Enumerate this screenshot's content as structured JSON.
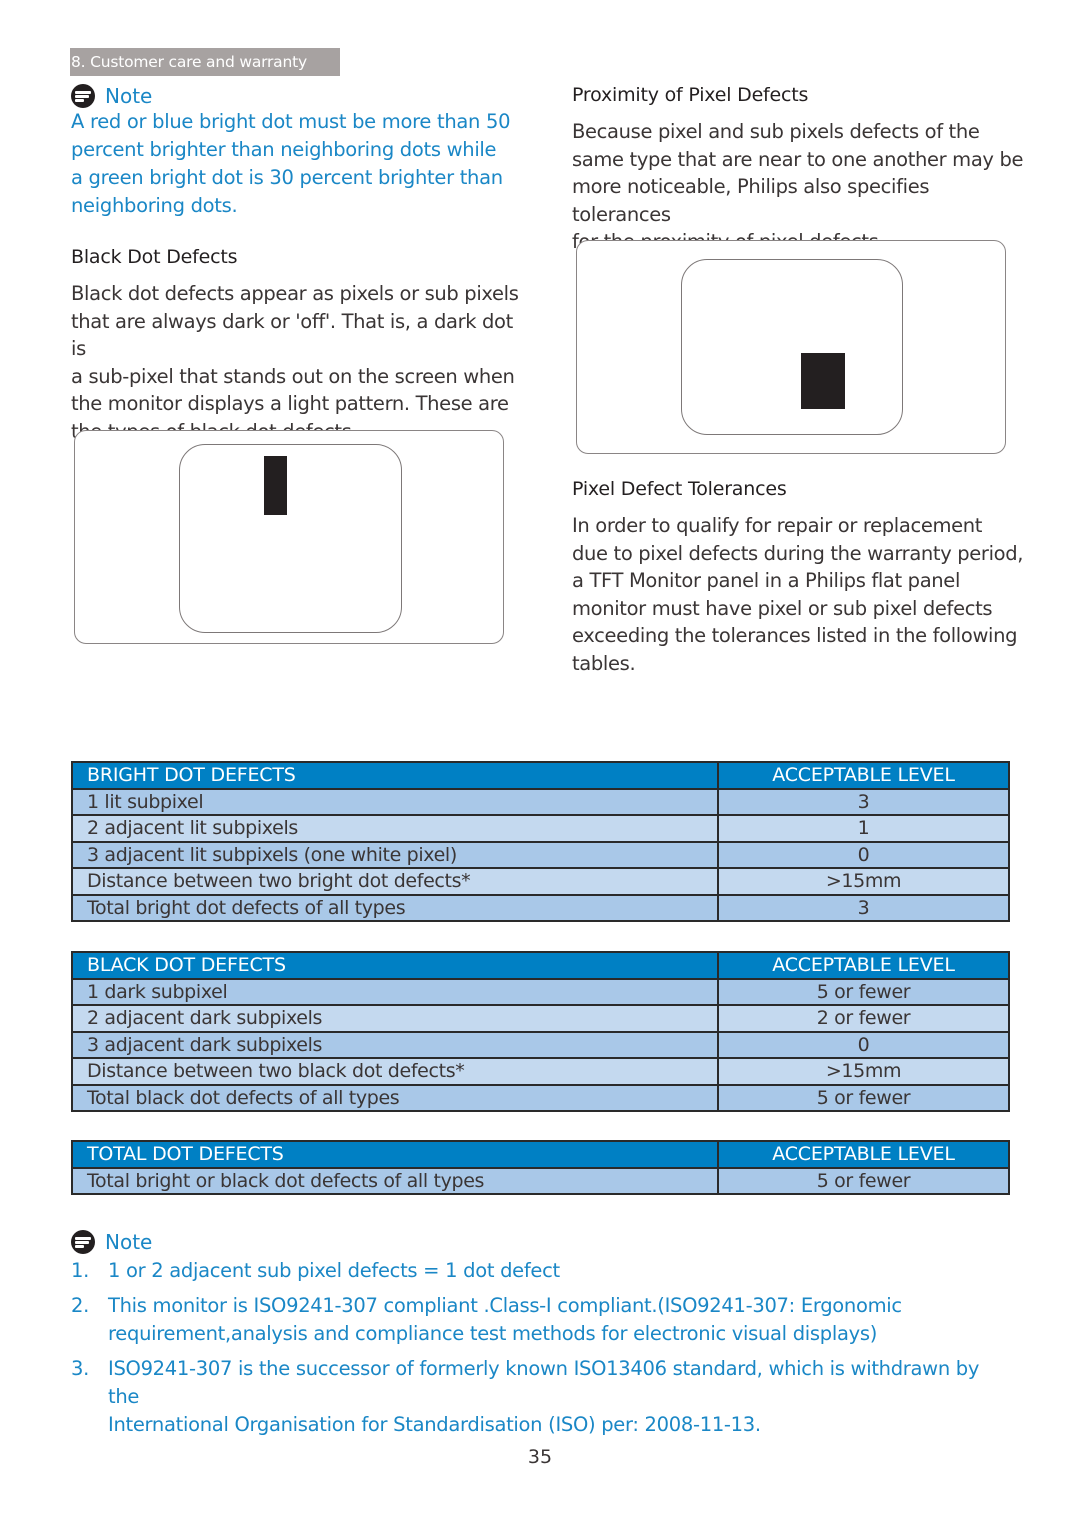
{
  "header": {
    "section_tab": "8. Customer care and warranty"
  },
  "note_top": {
    "title": "Note",
    "lines": [
      "A red or blue bright dot must be more than 50",
      "percent brighter than neighboring dots while",
      "a green bright dot is 30 percent brighter than",
      "neighboring dots."
    ]
  },
  "black_dot": {
    "heading": "Black Dot Defects",
    "lines": [
      "Black dot defects appear as pixels or sub pixels",
      "that are always dark or 'off'. That is, a dark dot is",
      "a sub-pixel that stands out on the screen when",
      "the monitor displays a light pattern. These are",
      "the types of black dot defects."
    ],
    "illustration_icon": "single-dark-subpixel-icon"
  },
  "proximity": {
    "heading": "Proximity of Pixel Defects",
    "lines": [
      "Because pixel and sub pixels defects of the",
      "same type that are near to one another may be",
      "more noticeable, Philips also specifies tolerances",
      "for the proximity of pixel defects."
    ],
    "illustration_icon": "dark-pixel-proximity-icon"
  },
  "tolerances": {
    "heading": "Pixel Defect Tolerances",
    "lines": [
      "In order to qualify for repair or replacement",
      "due to pixel defects during the warranty period,",
      "a TFT Monitor panel in a Philips flat panel",
      "monitor must have pixel or sub pixel defects",
      "exceeding the tolerances listed in the following",
      "tables."
    ]
  },
  "tables": {
    "bright": {
      "header": [
        "BRIGHT DOT DEFECTS",
        "ACCEPTABLE LEVEL"
      ],
      "rows": [
        [
          "1 lit subpixel",
          "3"
        ],
        [
          "2 adjacent lit subpixels",
          "1"
        ],
        [
          "3 adjacent lit subpixels (one white pixel)",
          "0"
        ],
        [
          "Distance between two bright dot defects*",
          ">15mm"
        ],
        [
          "Total bright dot defects of all types",
          "3"
        ]
      ]
    },
    "black": {
      "header": [
        "BLACK DOT DEFECTS",
        "ACCEPTABLE LEVEL"
      ],
      "rows": [
        [
          "1 dark subpixel",
          "5 or fewer"
        ],
        [
          "2 adjacent dark subpixels",
          "2 or fewer"
        ],
        [
          "3 adjacent dark subpixels",
          "0"
        ],
        [
          "Distance between two black dot defects*",
          ">15mm"
        ],
        [
          "Total black dot defects of all types",
          "5 or fewer"
        ]
      ]
    },
    "total": {
      "header": [
        "TOTAL DOT DEFECTS",
        "ACCEPTABLE LEVEL"
      ],
      "rows": [
        [
          "Total bright or black dot defects of all types",
          "5 or fewer"
        ]
      ]
    }
  },
  "note_bottom": {
    "title": "Note",
    "items": [
      {
        "num": "1.",
        "lines": [
          "1 or 2 adjacent sub pixel defects = 1 dot defect"
        ]
      },
      {
        "num": "2.",
        "lines": [
          "This monitor is ISO9241-307 compliant .Class-I compliant.(ISO9241-307: Ergonomic",
          "requirement,analysis and compliance test methods for electronic visual displays)"
        ]
      },
      {
        "num": "3.",
        "lines": [
          "ISO9241-307 is the successor of formerly known ISO13406 standard, which is withdrawn by the",
          "International Organisation for Standardisation (ISO) per: 2008-11-13."
        ]
      }
    ]
  },
  "footer": {
    "page_number": "35"
  },
  "colors": {
    "accent_blue": "#1a87c6",
    "table_header": "#0080c4",
    "row_dark": "#a9c8e8",
    "row_light": "#c4d9ef",
    "tab_gray": "#a7a2a1"
  }
}
